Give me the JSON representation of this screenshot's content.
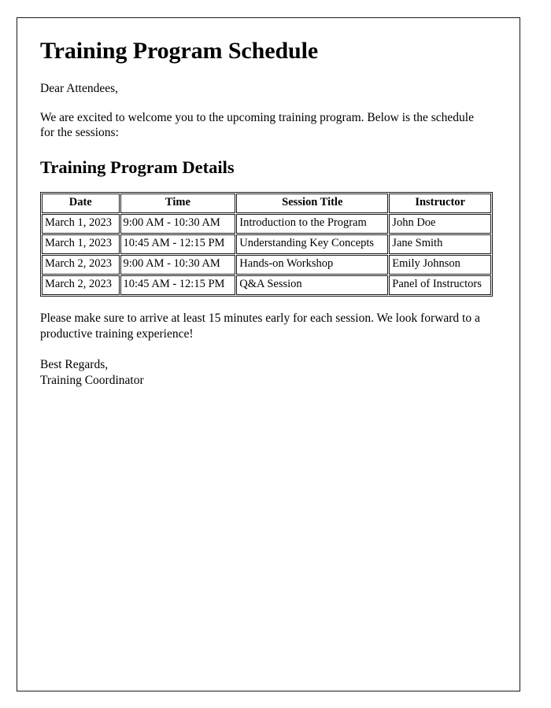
{
  "document": {
    "title": "Training Program Schedule",
    "salutation": "Dear Attendees,",
    "intro_paragraph": "We are excited to welcome you to the upcoming training program. Below is the schedule for the sessions:",
    "section_title": "Training Program Details",
    "closing_paragraph": "Please make sure to arrive at least 15 minutes early for each session. We look forward to a productive training experience!",
    "signoff_line_1": "Best Regards,",
    "signoff_line_2": "Training Coordinator"
  },
  "schedule_table": {
    "columns": [
      {
        "key": "date",
        "label": "Date"
      },
      {
        "key": "time",
        "label": "Time"
      },
      {
        "key": "session",
        "label": "Session Title"
      },
      {
        "key": "instructor",
        "label": "Instructor"
      }
    ],
    "rows": [
      {
        "date": "March 1, 2023",
        "time": "9:00 AM - 10:30 AM",
        "session": "Introduction to the Program",
        "instructor": "John Doe"
      },
      {
        "date": "March 1, 2023",
        "time": "10:45 AM - 12:15 PM",
        "session": "Understanding Key Concepts",
        "instructor": "Jane Smith"
      },
      {
        "date": "March 2, 2023",
        "time": "9:00 AM - 10:30 AM",
        "session": "Hands-on Workshop",
        "instructor": "Emily Johnson"
      },
      {
        "date": "March 2, 2023",
        "time": "10:45 AM - 12:15 PM",
        "session": "Q&A Session",
        "instructor": "Panel of Instructors"
      }
    ]
  },
  "style": {
    "text_color": "#000000",
    "border_color": "#1a1a1a",
    "page_background": "#ffffff"
  }
}
